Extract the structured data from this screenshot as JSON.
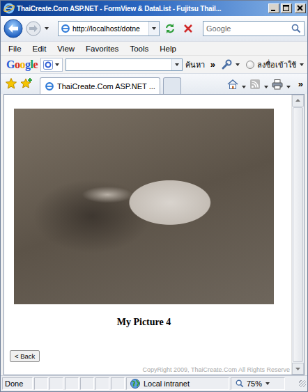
{
  "window": {
    "title": "ThaiCreate.Com ASP.NET - FormView & DataList - Fujitsu Thail..."
  },
  "address_bar": {
    "url": "http://localhost/dotne"
  },
  "search": {
    "placeholder": "Google"
  },
  "menu": [
    "File",
    "Edit",
    "View",
    "Favorites",
    "Tools",
    "Help"
  ],
  "google_toolbar": {
    "logo": "Google",
    "search_button": "ค้นหา",
    "more": "»",
    "sign_in": "ลงชื่อเข้าใช้"
  },
  "tabs": [
    {
      "label": "ThaiCreate.Com ASP.NET ...",
      "selected": true
    }
  ],
  "command_bar": {
    "more": "»"
  },
  "page": {
    "caption": "My Picture 4",
    "back_button": "< Back",
    "footer": "CopyRight 2009, ThaiCreate.Com All Rights Reserve"
  },
  "status_bar": {
    "text": "Done",
    "zone": "Local intranet",
    "zoom": "75%"
  }
}
